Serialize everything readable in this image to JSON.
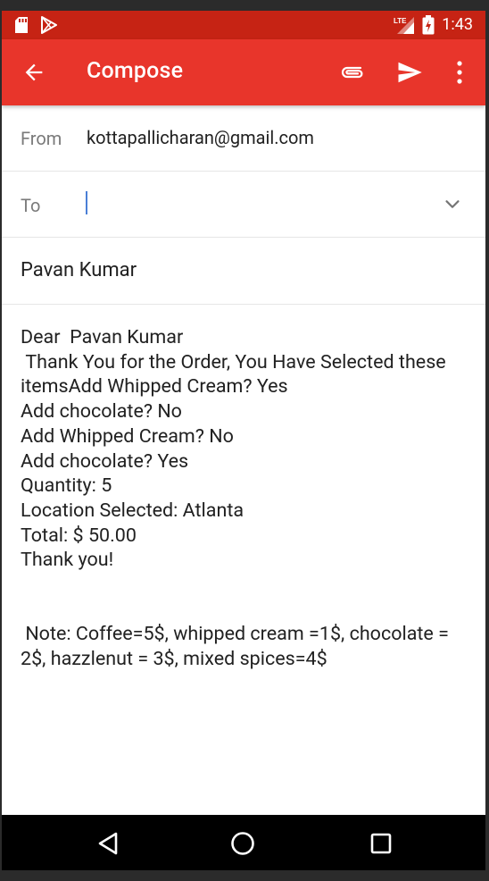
{
  "status_bar": {
    "time": "1:43",
    "network": "LTE",
    "battery_charging": true,
    "icons": [
      "sd-card-icon",
      "play-store-icon",
      "lte-signal-icon",
      "battery-icon"
    ]
  },
  "app_bar": {
    "title": "Compose",
    "color": "#e8352b",
    "status_color": "#c62314",
    "icons": [
      "back-arrow-icon",
      "attach-icon",
      "send-icon",
      "more-vert-icon"
    ]
  },
  "from": {
    "label": "From",
    "value": "kottapallicharan@gmail.com"
  },
  "to": {
    "label": "To",
    "value": ""
  },
  "subject": {
    "value": "Pavan Kumar"
  },
  "body": {
    "text": "Dear  Pavan Kumar\n Thank You for the Order, You Have Selected these itemsAdd Whipped Cream? Yes\nAdd chocolate? No\nAdd Whipped Cream? No\nAdd chocolate? Yes\nQuantity: 5\nLocation Selected: Atlanta\nTotal: $ 50.00\nThank you!\n\n\n Note: Coffee=5$, whipped cream =1$, chocolate = 2$, hazzlenut = 3$, mixed spices=4$"
  },
  "nav_bar": {
    "icons": [
      "nav-back-icon",
      "nav-home-icon",
      "nav-recents-icon"
    ]
  }
}
